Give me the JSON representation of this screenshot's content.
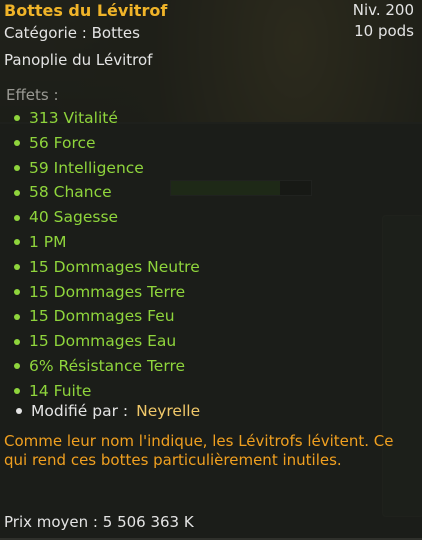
{
  "item": {
    "name": "Bottes du Lévitrof",
    "level": "Niv. 200",
    "weight": "10 pods",
    "category": "Catégorie : Bottes",
    "set": "Panoplie du Lévitrof"
  },
  "effects": {
    "title": "Effets :",
    "list": [
      "313 Vitalité",
      "56 Force",
      "59 Intelligence",
      "58 Chance",
      "40 Sagesse",
      "1 PM",
      "15 Dommages Neutre",
      "15 Dommages Terre",
      "15 Dommages Feu",
      "15 Dommages Eau",
      "6% Résistance Terre",
      "14 Fuite"
    ]
  },
  "modified": {
    "label": "Modifié par :",
    "author": "Neyrelle"
  },
  "description": "Comme leur nom l'indique, les Lévitrofs lévitent. Ce qui rend ces bottes particulièrement inutiles.",
  "price": "Prix moyen : 5 506 363 K",
  "colors": {
    "title": "#f0b429",
    "effect": "#8fd53c",
    "description": "#f0a020",
    "author": "#f0c86a"
  }
}
